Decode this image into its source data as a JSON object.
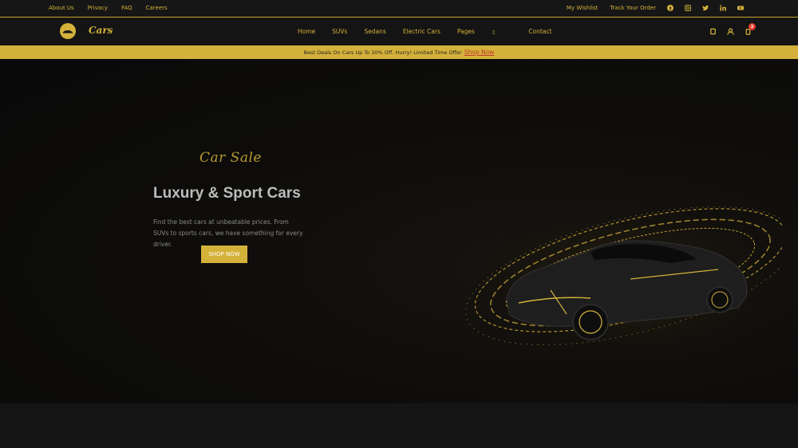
{
  "topbar": {
    "left_links": [
      "About Us",
      "Privacy",
      "FAQ",
      "Careers"
    ],
    "right_links": [
      "My Wishlist",
      "Track Your Order"
    ],
    "social_icons": [
      "facebook-icon",
      "instagram-icon",
      "twitter-icon",
      "linkedin-icon",
      "youtube-icon"
    ]
  },
  "header": {
    "logo_text": "Cars",
    "nav": [
      "Home",
      "SUVs",
      "Sedans",
      "Electric Cars",
      "Pages",
      "Contact"
    ],
    "pages_caret": "▯",
    "icons": [
      "search-icon",
      "user-icon",
      "cart-icon"
    ],
    "cart_count": "2"
  },
  "promo": {
    "message": "Best Deals On Cars Up To 30% Off. Hurry! Limited Time Offer",
    "link_text": "Shop Now"
  },
  "hero": {
    "script_title": "Car Sale",
    "title": "Luxury & Sport Cars",
    "description": "Find the best cars at unbeatable prices. From SUVs to sports cars, we have something for every driver.",
    "cta_label": "SHOP NOW"
  },
  "colors": {
    "accent": "#d4b23a",
    "background": "#121212",
    "badge": "#e23b2e"
  }
}
